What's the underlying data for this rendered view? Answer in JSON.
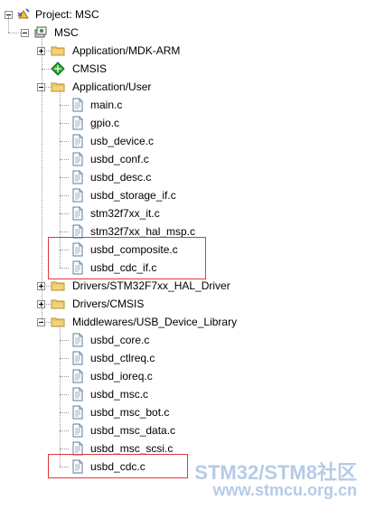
{
  "project": {
    "label": "Project: MSC",
    "target": "MSC",
    "groups": [
      {
        "label": "Application/MDK-ARM",
        "icon": "folder-icon",
        "expanded": false,
        "files": []
      },
      {
        "label": "CMSIS",
        "icon": "cmsis-component-icon",
        "expanded": null,
        "files": []
      },
      {
        "label": "Application/User",
        "icon": "folder-icon",
        "expanded": true,
        "files": [
          "main.c",
          "gpio.c",
          "usb_device.c",
          "usbd_conf.c",
          "usbd_desc.c",
          "usbd_storage_if.c",
          "stm32f7xx_it.c",
          "stm32f7xx_hal_msp.c",
          "usbd_composite.c",
          "usbd_cdc_if.c"
        ]
      },
      {
        "label": "Drivers/STM32F7xx_HAL_Driver",
        "icon": "folder-icon",
        "expanded": false,
        "files": []
      },
      {
        "label": "Drivers/CMSIS",
        "icon": "folder-icon",
        "expanded": false,
        "files": []
      },
      {
        "label": "Middlewares/USB_Device_Library",
        "icon": "folder-icon",
        "expanded": true,
        "files": [
          "usbd_core.c",
          "usbd_ctlreq.c",
          "usbd_ioreq.c",
          "usbd_msc.c",
          "usbd_msc_bot.c",
          "usbd_msc_data.c",
          "usbd_msc_scsi.c",
          "usbd_cdc.c"
        ]
      }
    ]
  },
  "highlights": [
    {
      "group": 2,
      "from_file": 8,
      "to_file": 9,
      "color": "#e0383c"
    },
    {
      "group": 5,
      "from_file": 7,
      "to_file": 7,
      "color": "#e0383c"
    }
  ],
  "watermark": {
    "line1": "STM32/STM8社区",
    "line2": "www.stmcu.org.cn"
  }
}
